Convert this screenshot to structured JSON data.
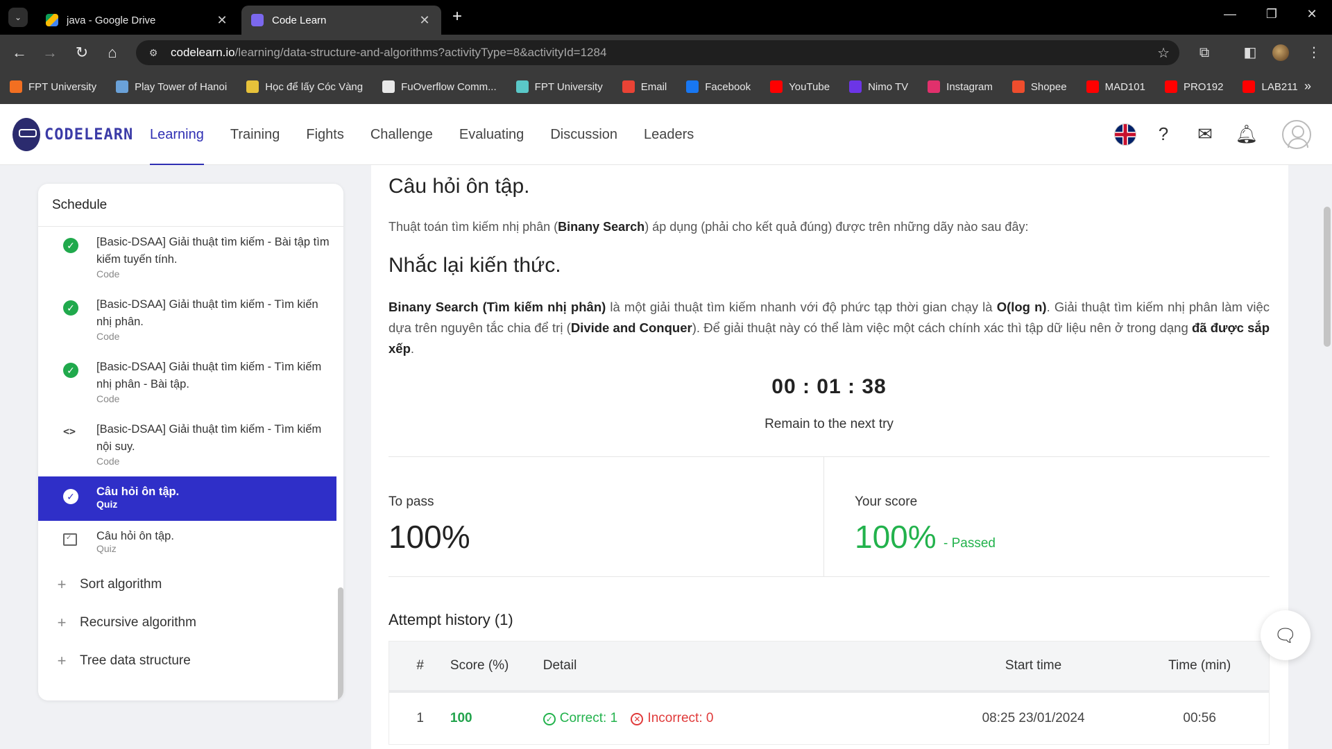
{
  "browser": {
    "tabs": [
      {
        "title": "java - Google Drive",
        "favicon_color": "#fbbc04"
      },
      {
        "title": "Code Learn",
        "favicon_color": "#7b68ee"
      }
    ],
    "url_host": "codelearn.io",
    "url_path": "/learning/data-structure-and-algorithms?activityType=8&activityId=1284",
    "bookmarks": [
      {
        "label": "FPT University",
        "icon_color": "#f26f21"
      },
      {
        "label": "Play Tower of Hanoi",
        "icon_color": "#6aa1d8"
      },
      {
        "label": "Học để lấy Cóc Vàng",
        "icon_color": "#e7c23a"
      },
      {
        "label": "FuOverflow Comm...",
        "icon_color": "#e8e8e8"
      },
      {
        "label": "FPT University",
        "icon_color": "#5ac8c8"
      },
      {
        "label": "Email",
        "icon_color": "#ea4335"
      },
      {
        "label": "Facebook",
        "icon_color": "#1877f2"
      },
      {
        "label": "YouTube",
        "icon_color": "#ff0000"
      },
      {
        "label": "Nimo TV",
        "icon_color": "#6c35e6"
      },
      {
        "label": "Instagram",
        "icon_color": "#e1306c"
      },
      {
        "label": "Shopee",
        "icon_color": "#ee4d2d"
      },
      {
        "label": "MAD101",
        "icon_color": "#ff0000"
      },
      {
        "label": "PRO192",
        "icon_color": "#ff0000"
      },
      {
        "label": "LAB211",
        "icon_color": "#ff0000"
      }
    ]
  },
  "header": {
    "logo_text": "CODELEARN",
    "nav": [
      "Learning",
      "Training",
      "Fights",
      "Challenge",
      "Evaluating",
      "Discussion",
      "Leaders"
    ],
    "active_nav": "Learning"
  },
  "sidebar": {
    "title": "Schedule",
    "items": [
      {
        "name": "[Basic-DSAA] Giải thuật tìm kiếm - Bài tập tìm kiếm tuyến tính.",
        "type": "Code",
        "icon": "check-circle-icon"
      },
      {
        "name": "[Basic-DSAA] Giải thuật tìm kiếm - Tìm kiến nhị phân.",
        "type": "Code",
        "icon": "check-circle-icon"
      },
      {
        "name": "[Basic-DSAA] Giải thuật tìm kiếm - Tìm kiếm nhị phân - Bài tập.",
        "type": "Code",
        "icon": "check-circle-icon"
      },
      {
        "name": "[Basic-DSAA] Giải thuật tìm kiếm - Tìm kiếm nội suy.",
        "type": "Code",
        "icon": "code-icon"
      },
      {
        "name": "Câu hỏi ôn tập.",
        "type": "Quiz",
        "icon": "check-circle-icon"
      },
      {
        "name": "Câu hỏi ôn tập.",
        "type": "Quiz",
        "icon": "quiz-icon"
      }
    ],
    "sections": [
      "Sort algorithm",
      "Recursive algorithm",
      "Tree data structure"
    ]
  },
  "main": {
    "question_title": "Câu hỏi ôn tập.",
    "question_pre": "Thuật toán tìm kiếm nhị phân (",
    "question_bold": "Binany Search",
    "question_post": ") áp dụng (phải cho kết quả đúng) được trên những dãy nào sau đây:",
    "recall_title": "Nhắc lại kiến thức.",
    "para": {
      "b1": "Binany Search (Tìm kiếm nhị phân)",
      "t1": " là một giải thuật tìm kiếm nhanh với độ phức tạp thời gian chạy là ",
      "b2": "O(log n)",
      "t2": ". Giải thuật tìm kiếm nhị phân làm việc dựa trên nguyên tắc chia để trị (",
      "b3": "Divide and Conquer",
      "t3": "). Để giải thuật này có thể làm việc một cách chính xác thì tập dữ liệu nên ở trong dạng ",
      "b4": "đã được sắp xếp",
      "t4": "."
    },
    "timer": "00 : 01 : 38",
    "timer_caption": "Remain to the next try",
    "to_pass_label": "To pass",
    "to_pass_value": "100%",
    "your_score_label": "Your score",
    "your_score_value": "100%",
    "passed_text": "- Passed",
    "history_title": "Attempt history (1)",
    "history_headers": [
      "#",
      "Score (%)",
      "Detail",
      "Start time",
      "Time (min)"
    ],
    "history_rows": [
      {
        "num": "1",
        "score": "100",
        "correct_label": "Correct: 1",
        "incorrect_label": "Incorrect: 0",
        "start": "08:25 23/01/2024",
        "time": "00:56"
      }
    ]
  }
}
